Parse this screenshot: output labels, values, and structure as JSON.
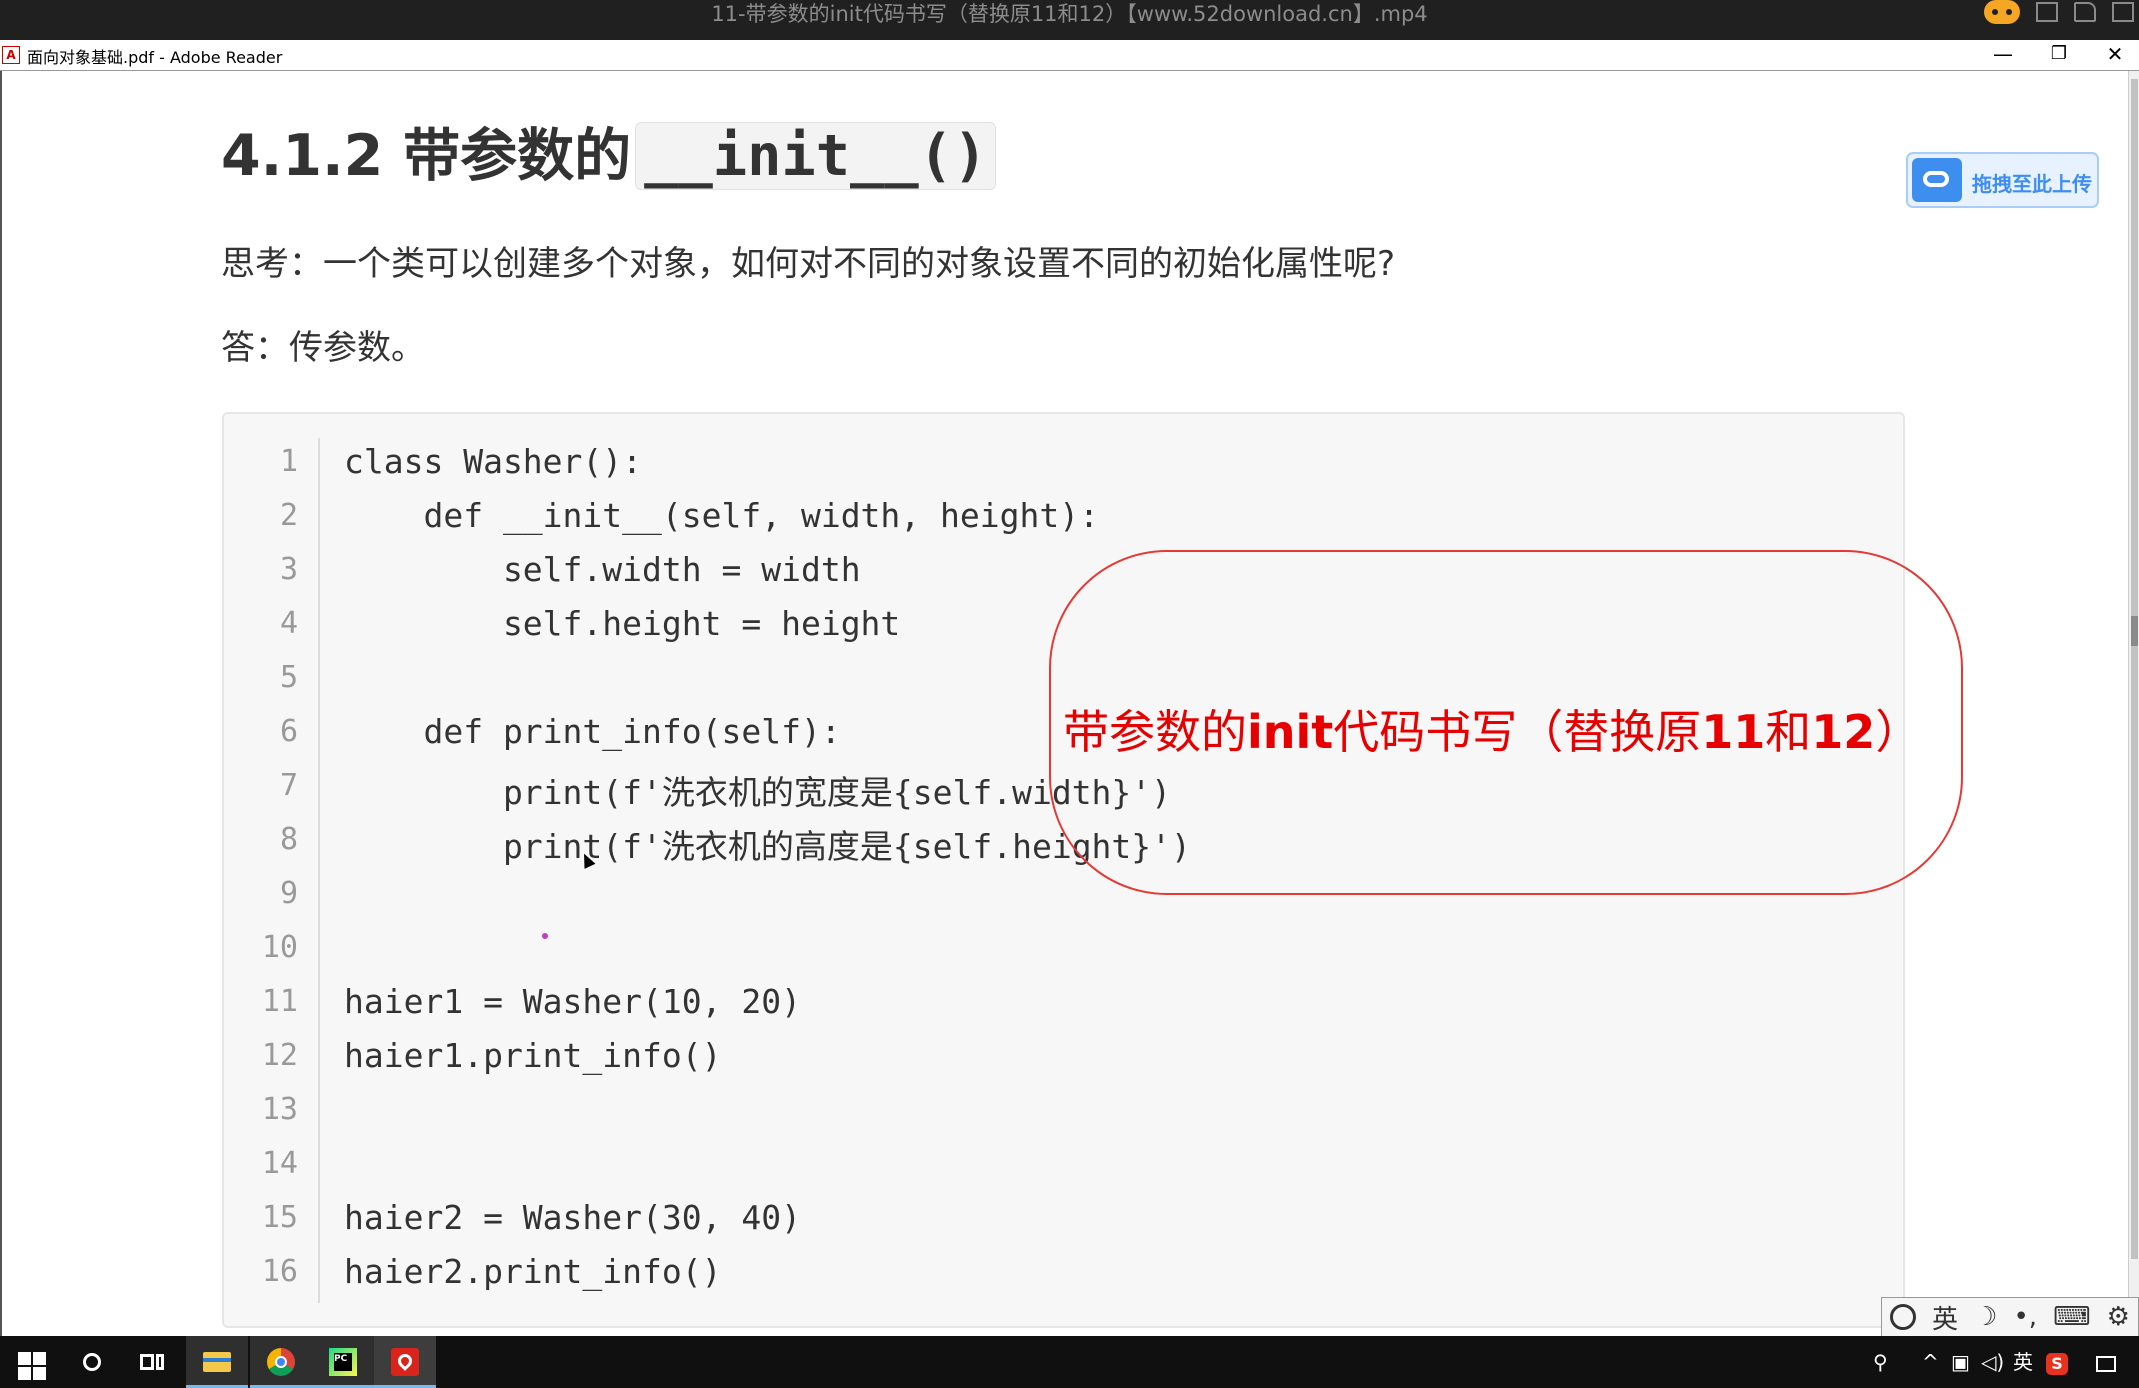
{
  "player": {
    "title": "11-带参数的init代码书写（替换原11和12）【www.52download.cn】.mp4"
  },
  "reader": {
    "title": "面向对象基础.pdf - Adobe Reader",
    "minimize": "—",
    "restore": "❐",
    "close": "✕"
  },
  "document": {
    "heading_prefix": "4.1.2 带参数的",
    "heading_code": "__init__()",
    "question": "思考：一个类可以创建多个对象，如何对不同的对象设置不同的初始化属性呢?",
    "answer": "答：传参数。"
  },
  "upload_button": {
    "label": "拖拽至此上传"
  },
  "code": {
    "line_numbers": [
      "1",
      "2",
      "3",
      "4",
      "5",
      "6",
      "7",
      "8",
      "9",
      "10",
      "11",
      "12",
      "13",
      "14",
      "15",
      "16"
    ],
    "lines": [
      "class Washer():",
      "    def __init__(self, width, height):",
      "        self.width = width",
      "        self.height = height",
      "",
      "    def print_info(self):",
      "        print(f'洗衣机的宽度是{self.width}')",
      "        print(f'洗衣机的高度是{self.height}')",
      "",
      "",
      "haier1 = Washer(10, 20)",
      "haier1.print_info()",
      "",
      "",
      "haier2 = Washer(30, 40)",
      "haier2.print_info()"
    ]
  },
  "annotation": {
    "part1": "带参数的",
    "part2": "init",
    "part3": "代码书写（替换原",
    "part4": "11",
    "part5": "和",
    "part6": "12",
    "part7": "）"
  },
  "ime": {
    "mode": "英",
    "moon": "☽",
    "punct": "•,",
    "keyboard": "⌨",
    "settings": "⚙"
  },
  "tray": {
    "lang": "英",
    "chevron": "^"
  },
  "icons": {
    "start": "windows-logo-icon",
    "search": "search-circle-icon",
    "taskview": "task-view-icon",
    "explorer": "folder-icon",
    "chrome": "chrome-icon",
    "pycharm": "pycharm-icon",
    "acrobat": "acrobat-icon"
  }
}
